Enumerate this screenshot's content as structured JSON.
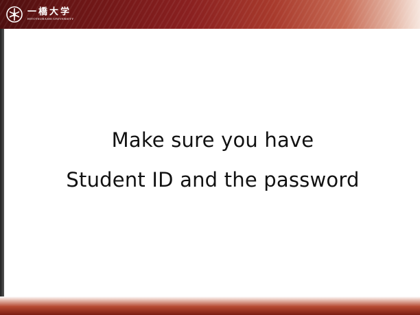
{
  "header": {
    "logo_kanji": "一橋大学",
    "logo_roman": "HITOTSUBASHI UNIVERSITY"
  },
  "content": {
    "lines": [
      "Make sure you have",
      "Student ID and the password"
    ]
  },
  "colors": {
    "header_dark": "#6d1616",
    "header_light": "#f7e7df",
    "footer_dark": "#7c1d12",
    "text": "#111111"
  }
}
